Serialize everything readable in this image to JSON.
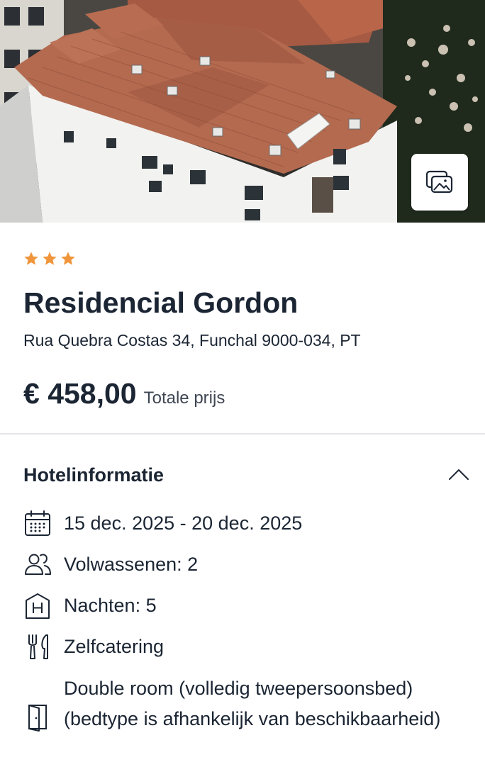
{
  "hero": {
    "image_subject": "Aerial view of a white building with terracotta tile roofs",
    "gallery_button_icon": "image-gallery-icon"
  },
  "hotel": {
    "star_rating": 3,
    "star_color": "#f0953b",
    "name": "Residencial Gordon",
    "address": "Rua Quebra Costas 34, Funchal 9000-034, PT",
    "price": "€ 458,00",
    "price_label": "Totale prijs"
  },
  "hotel_info": {
    "title": "Hotelinformatie",
    "toggle_icon": "chevron-up-icon",
    "items": [
      {
        "icon": "calendar-icon",
        "text": "15 dec. 2025 - 20 dec. 2025"
      },
      {
        "icon": "people-icon",
        "text": "Volwassenen: 2"
      },
      {
        "icon": "hotel-icon",
        "text": "Nachten: 5"
      },
      {
        "icon": "cutlery-icon",
        "text": "Zelfcatering"
      },
      {
        "icon": "door-icon",
        "text": "Double room (volledig tweepersoonsbed) (bedtype is afhankelijk van beschikbaarheid)"
      }
    ]
  }
}
